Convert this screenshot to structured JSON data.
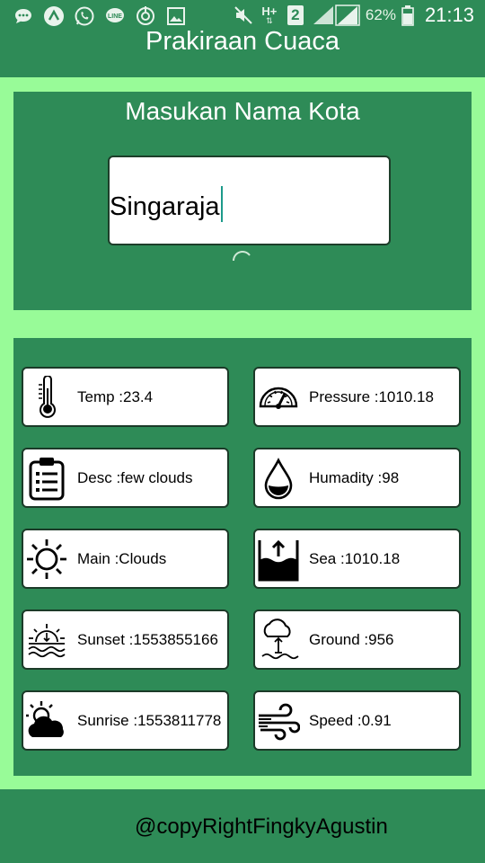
{
  "status_bar": {
    "icons": [
      "chat-icon",
      "arrow-up-circle-icon",
      "whatsapp-icon",
      "line-icon",
      "sync-icon",
      "gallery-icon",
      "mute-icon",
      "hplus-signal-icon",
      "sim-2-icon",
      "signal-icon",
      "battery-icon"
    ],
    "network_label": "H+",
    "sim_label": "2",
    "battery": "62%",
    "time": "21:13"
  },
  "app": {
    "title": "Prakiraan Cuaca"
  },
  "search": {
    "label": "Masukan Nama Kota",
    "city_value": "Singaraja"
  },
  "weather": {
    "temp": "Temp :23.4",
    "pressure": "Pressure :1010.18",
    "desc": "Desc :few clouds",
    "humidity": "Humadity :98",
    "main": "Main :Clouds",
    "sea": "Sea :1010.18",
    "sunset": "Sunset :1553855166",
    "ground": "Ground :956",
    "sunrise": "Sunrise :1553811778",
    "speed": "Speed :0.91"
  },
  "icons": {
    "temp": "thermometer-icon",
    "pressure": "gauge-icon",
    "desc": "clipboard-icon",
    "humidity": "water-drop-icon",
    "main": "sun-icon",
    "sea": "sea-level-icon",
    "sunset": "sunset-icon",
    "ground": "ground-level-icon",
    "sunrise": "sunrise-icon",
    "speed": "wind-icon"
  },
  "footer": {
    "text": "@copyRightFingkyAgustin"
  },
  "colors": {
    "primary_dark_green": "#2e8b57",
    "frame_light_green": "#98fb98",
    "card_white": "#ffffff",
    "text_white": "#ffffff",
    "caret": "#1c9a8a"
  }
}
